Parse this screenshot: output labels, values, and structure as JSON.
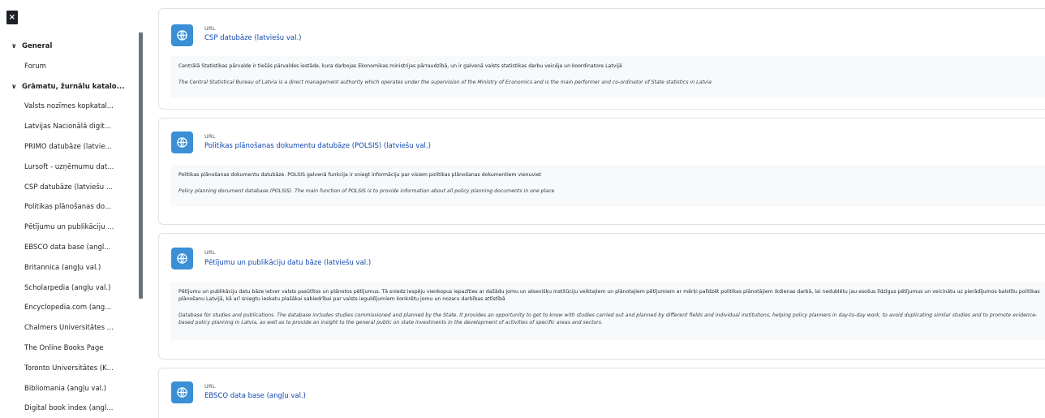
{
  "drawer": {
    "close_glyph": "×",
    "items": [
      {
        "label": "General",
        "kind": "section"
      },
      {
        "label": "Forum",
        "kind": "child"
      },
      {
        "label": "Grāmatu, žurnālu katalo...",
        "kind": "section"
      },
      {
        "label": "Valsts nozīmes kopkatal...",
        "kind": "child"
      },
      {
        "label": "Latvijas Nacionālā digit...",
        "kind": "child"
      },
      {
        "label": "PRIMO datubāze (latvie...",
        "kind": "child"
      },
      {
        "label": "Lursoft - uzņēmumu dat...",
        "kind": "child"
      },
      {
        "label": "CSP datubāze (latviešu ...",
        "kind": "child"
      },
      {
        "label": "Politikas plānošanas do...",
        "kind": "child"
      },
      {
        "label": "Pētījumu un publikāciju ...",
        "kind": "child"
      },
      {
        "label": "EBSCO data base (angl...",
        "kind": "child"
      },
      {
        "label": "Britannica (angļu val.)",
        "kind": "child"
      },
      {
        "label": "Scholarpedia (angļu val.)",
        "kind": "child"
      },
      {
        "label": "Encyclopedia.com (ang...",
        "kind": "child"
      },
      {
        "label": "Chalmers Universitātes ...",
        "kind": "child"
      },
      {
        "label": "The Online Books Page",
        "kind": "child"
      },
      {
        "label": "Toronto Universitātes (K...",
        "kind": "child"
      },
      {
        "label": "Bibliomania (angļu val.)",
        "kind": "child"
      },
      {
        "label": "Digital book index (angl...",
        "kind": "child"
      }
    ]
  },
  "activities": [
    {
      "type": "URL",
      "title": "CSP datubāze (latviešu val.)",
      "desc_lv": "Centrālā Statistikas pārvalde ir tiešās pārvaldes iestāde, kura darbojas Ekonomikas ministrijas pārraudzībā, un ir galvenā valsts statistikas darbu veicēja un koordinatore Latvijā",
      "desc_en": "The Central Statistical Bureau of Latvia is a direct management authority which operates under the supervision of the Ministry of Economics and is the main performer and co-ordinator of State statistics in Latvia"
    },
    {
      "type": "URL",
      "title": "Politikas plānošanas dokumentu datubāze (POLSIS) (latviešu val.)",
      "desc_lv": "Politikas plānošanas dokumentu datubāze. POLSIS galvenā funkcija ir sniegt informāciju par visiem politikas plānošanas dokumentiem vienuviet",
      "desc_en": "Policy planning document database (POLSIS). The main function of POLSIS is to provide information about all policy planning documents in one place"
    },
    {
      "type": "URL",
      "title": "Pētījumu un publikāciju datu bāze (latviešu val.)",
      "desc_lv": "Pētījumu un publikāciju datu bāze ietver valsts pasūtītos un plānotos pētījumus. Tā sniedz iespēju vienkopus iepazīties ar dažādu jomu un atsevišķu institūciju veiktajiem un plānotajiem pētījumiem ar mērķi palīdzēt politikas plānotājiem ikdienas darbā, lai nedublētu jau esošus līdzīgus pētījumus un veicinātu uz pierādījumos balstītu politikas plānošanu Latvijā, kā arī sniegtu ieskatu plašākai sabiedrībai par valsts ieguldījumiem konkrētu jomu un nozaru darbības attīstībā",
      "desc_en": "Database for studies and publications. The database includes studies commissioned and planned by the State. It provides an opportunity to get to know with studies carried out and planned by different fields and individual institutions, helping policy planners in day-to-day work, to avoid duplicating similar studies and to promote evidence-based policy planning in Latvia, as well as to provide an insight to the general public on state investments in the development of activities of specific areas and sectors."
    },
    {
      "type": "URL",
      "title": "EBSCO data base (angļu val.)"
    }
  ],
  "colors": {
    "icon_bg": "#3a8fd6",
    "link": "#0f47ad",
    "desc_bg": "#f8f9fa"
  },
  "icons": {
    "activity": "globe-icon",
    "section_toggle": "chevron-down-icon",
    "close": "close-icon"
  }
}
